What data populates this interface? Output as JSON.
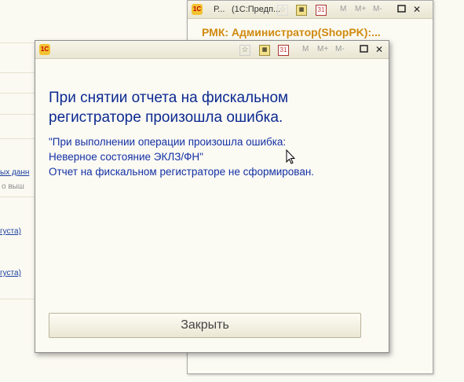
{
  "background": {
    "link_1": "ых данн",
    "faint_1": "о выш",
    "link_2": "густа)",
    "link_3": "густа)"
  },
  "back_window": {
    "tab_1": "Р...",
    "tab_2": "(1С:Предп...",
    "m_buttons": [
      "M",
      "M+",
      "M-"
    ],
    "title": "РМК: Администратор(ShopPK):..."
  },
  "dialog": {
    "m_buttons": [
      "M",
      "M+",
      "M-"
    ],
    "heading": "При снятии отчета на фискальном регистраторе произошла ошибка.",
    "detail_line_1": "\"При выполнении операции произошла ошибка:",
    "detail_line_2": "Неверное состояние ЭКЛЗ/ФН\"",
    "detail_line_3": "Отчет на фискальном регистраторе не сформирован.",
    "close_label": "Закрыть"
  },
  "logo_text": "1С",
  "calendar_text": "31",
  "icons": {
    "app": "app-logo-icon",
    "favorites": "star-icon",
    "calculator": "calculator-icon",
    "calendar": "calendar-icon",
    "maximize": "maximize-icon",
    "close": "close-icon"
  },
  "colors": {
    "heading": "#0c2a91",
    "detail": "#1431a5",
    "back_title": "#d08a0f",
    "window_bg": "#fbfaf3"
  }
}
